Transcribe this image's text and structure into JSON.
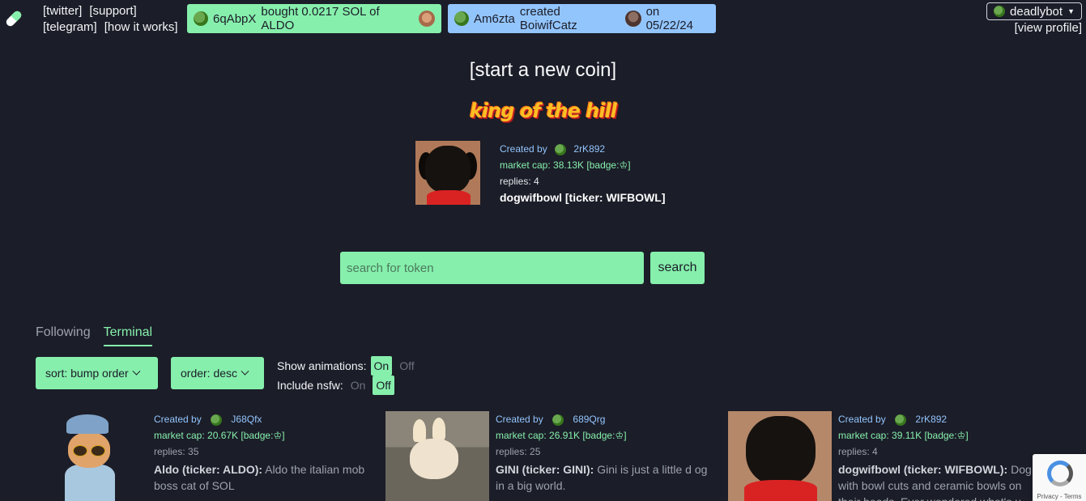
{
  "header": {
    "links_row1": [
      "[twitter]",
      "[support]"
    ],
    "links_row2": [
      "[telegram]",
      "[how it works]"
    ],
    "ticker_trade": {
      "user": "6qAbpX",
      "text": "bought 0.0217 SOL of ALDO"
    },
    "ticker_create": {
      "user": "Am6zta",
      "text": "created BoiwifCatz",
      "date": "on 05/22/24"
    },
    "username": "deadlybot",
    "view_profile": "[view profile]"
  },
  "hero": {
    "start_coin": "[start a new coin]",
    "koth_label": "king of the hill",
    "created_by_label": "Created by",
    "creator": "2rK892",
    "market_cap": "market cap: 38.13K",
    "badge": "[badge:",
    "badge_end": "]",
    "replies": "replies: 4",
    "title": "dogwifbowl [ticker: WIFBOWL]"
  },
  "search": {
    "placeholder": "search for token",
    "button": "search"
  },
  "tabs": {
    "following": "Following",
    "terminal": "Terminal"
  },
  "filters": {
    "sort": "sort: bump order",
    "order": "order: desc",
    "show_animations_label": "Show animations:",
    "include_nsfw_label": "Include nsfw:",
    "on": "On",
    "off": "Off"
  },
  "cards": [
    {
      "created_by": "Created by",
      "creator": "J68Qfx",
      "market_cap": "market cap: 20.67K",
      "badge": "[badge:",
      "badge_end": "]",
      "replies": "replies: 35",
      "name": "Aldo (ticker: ALDO):",
      "desc": "Aldo the italian mob boss cat of SOL"
    },
    {
      "created_by": "Created by",
      "creator": "689Qrg",
      "market_cap": "market cap: 26.91K",
      "badge": "[badge:",
      "badge_end": "]",
      "replies": "replies: 25",
      "name": "GINI (ticker: GINI):",
      "desc": "Gini is just a little d og in a big world."
    },
    {
      "created_by": "Created by",
      "creator": "2rK892",
      "market_cap": "market cap: 39.11K",
      "badge": "[badge:",
      "badge_end": "]",
      "replies": "replies: 4",
      "name": "dogwifbowl (ticker: WIFBOWL):",
      "desc": "Dog with bowl cuts and ceramic bowls on their heads. Ever wondered what's u"
    }
  ],
  "recaptcha": {
    "text": "Privacy - Terms"
  }
}
